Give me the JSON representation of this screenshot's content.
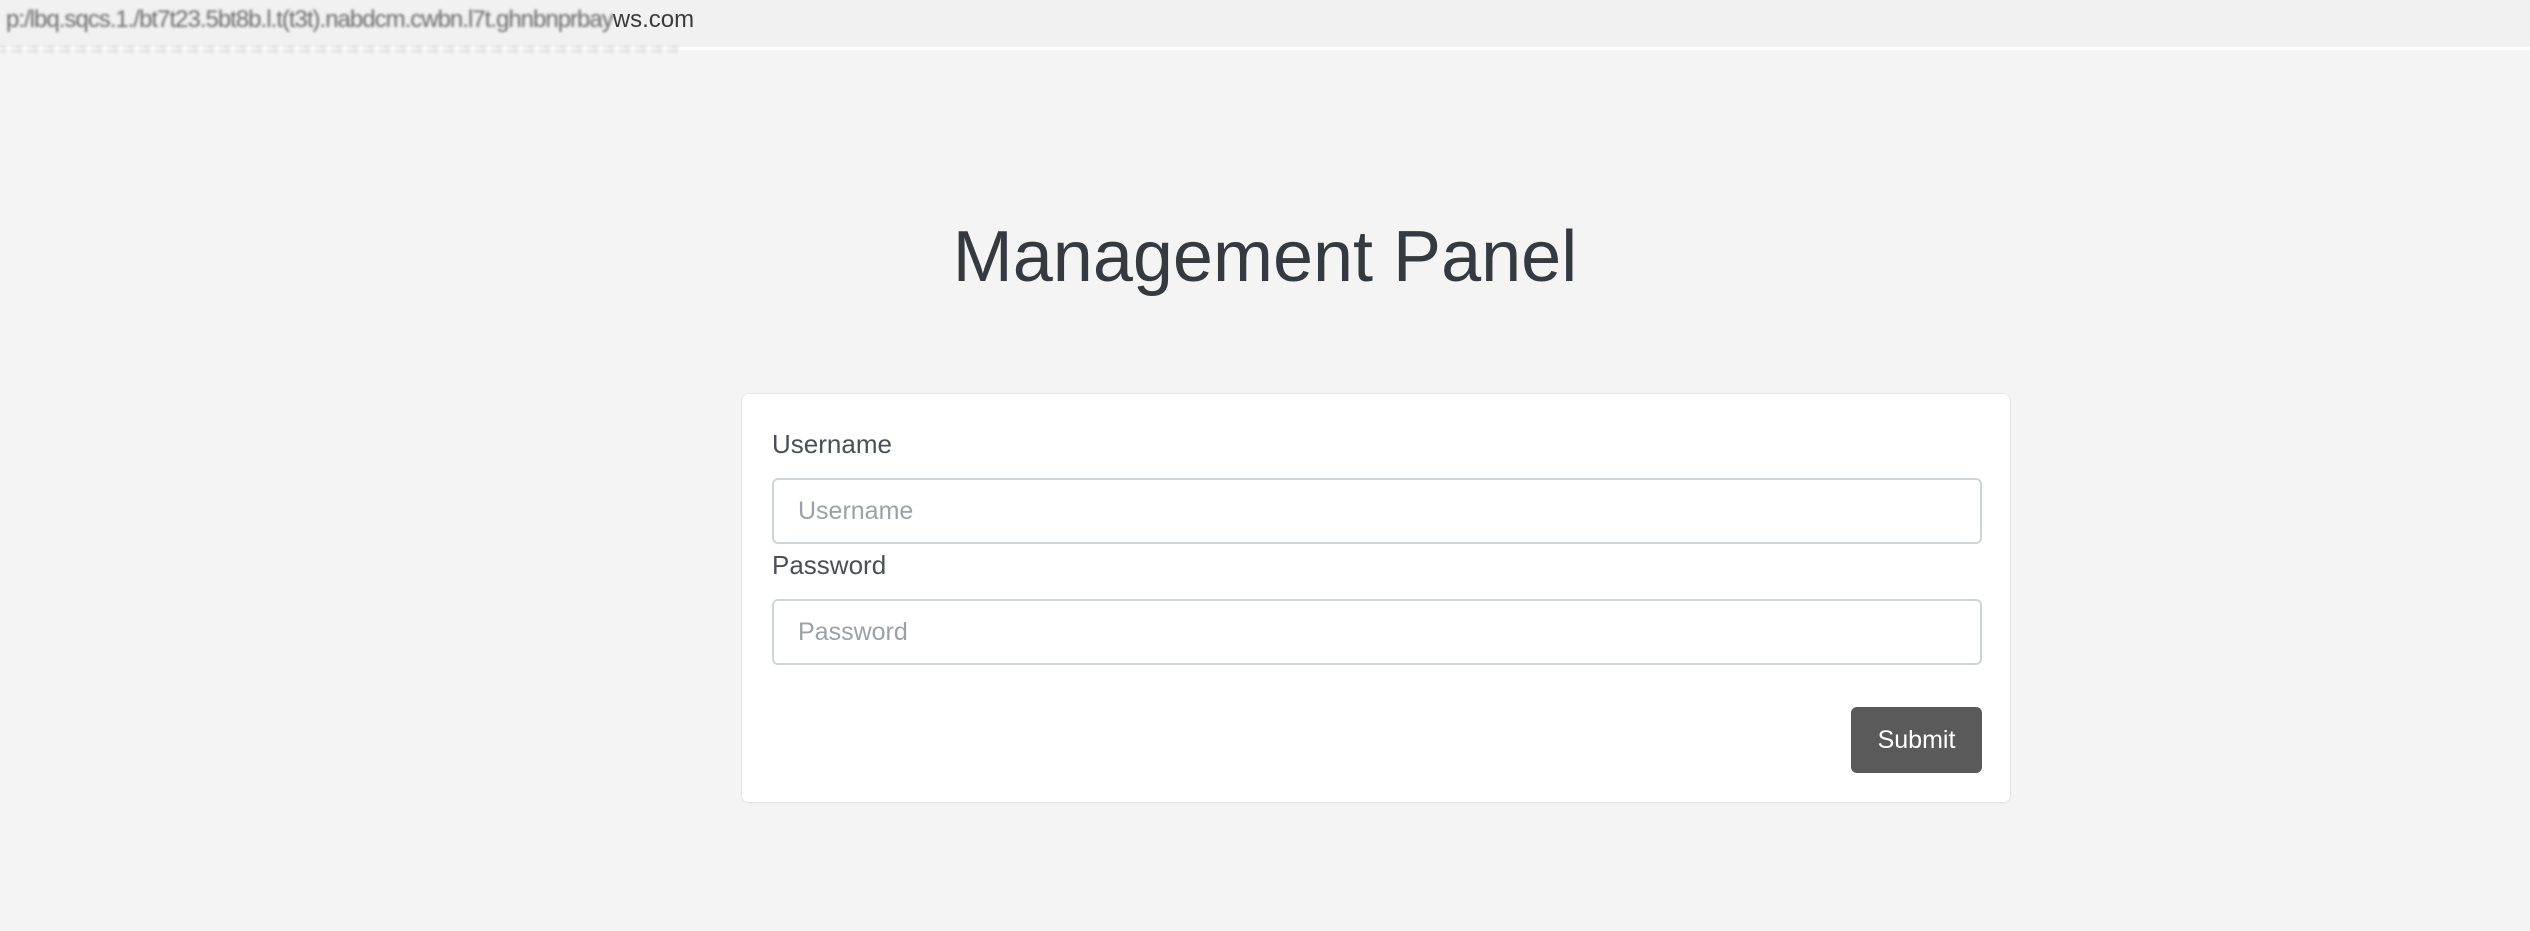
{
  "browser": {
    "url_visible_part": "ws.com"
  },
  "page": {
    "title": "Management Panel"
  },
  "form": {
    "username": {
      "label": "Username",
      "placeholder": "Username",
      "value": ""
    },
    "password": {
      "label": "Password",
      "placeholder": "Password",
      "value": ""
    },
    "submit_label": "Submit"
  },
  "colors": {
    "background": "#f4f4f4",
    "card": "#ffffff",
    "title_text": "#343a40",
    "submit_button": "#5a5a5a",
    "input_border": "#ced4da"
  }
}
